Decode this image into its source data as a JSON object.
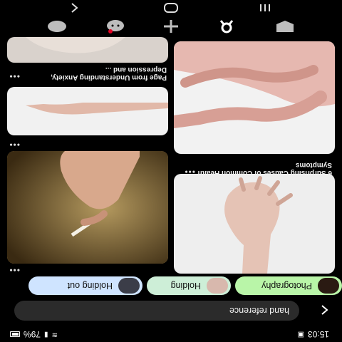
{
  "status_bar": {
    "time": "15:03",
    "battery": "79%",
    "icons": [
      "message-icon",
      "lock-icon",
      "wifi-icon",
      "signal-icon",
      "battery-icon"
    ]
  },
  "search": {
    "query": "hand reference",
    "back_icon": "back-arrow-icon"
  },
  "chips": [
    {
      "label": "Photography",
      "color": "#b9f5a8"
    },
    {
      "label": "Holding",
      "color": "#cdeed7"
    },
    {
      "label": "Holding out",
      "color": "#cfe4ff"
    }
  ],
  "pins": {
    "left_col": [
      {
        "caption": "",
        "menu": "•••"
      },
      {
        "caption": "6 Surprising Causes of Common Health Symptoms",
        "menu": "•••"
      }
    ],
    "right_col": [
      {
        "caption": "",
        "menu": "•••"
      },
      {
        "caption": "",
        "menu": "•••"
      },
      {
        "caption": "Page from Understanding Anxiety, Depression and ...",
        "menu": "•••"
      }
    ]
  },
  "bottom_nav": [
    "home-icon",
    "search-icon",
    "add-icon",
    "messages-icon",
    "profile-icon"
  ],
  "system_nav": [
    "recent-apps-icon",
    "home-button-icon",
    "back-icon"
  ]
}
